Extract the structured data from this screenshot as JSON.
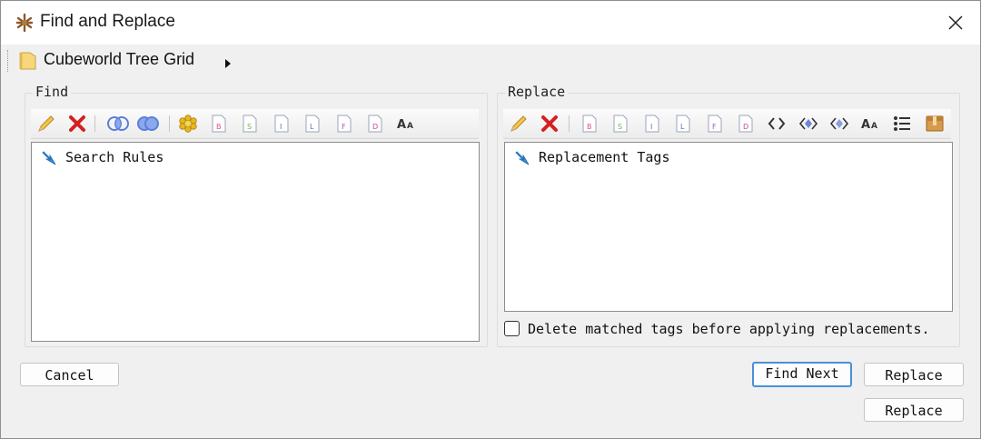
{
  "window": {
    "title": "Find and Replace"
  },
  "breadcrumb": {
    "label": "Cubeworld Tree Grid"
  },
  "find": {
    "legend": "Find",
    "toolbar": [
      "pencil-edit-icon",
      "delete-x-icon",
      "intersect-icon",
      "union-icon",
      "wildcard-icon",
      "doc-b-icon",
      "doc-s-icon",
      "doc-i-icon",
      "doc-l-icon",
      "doc-f-icon",
      "doc-d-icon",
      "font-case-icon"
    ],
    "root_item": "Search Rules"
  },
  "replace": {
    "legend": "Replace",
    "toolbar": [
      "pencil-edit-icon",
      "delete-x-icon",
      "doc-b-icon",
      "doc-s-icon",
      "doc-i-icon",
      "doc-l-icon",
      "doc-f-icon",
      "doc-d-icon",
      "code-brackets-icon",
      "diamond-left-icon",
      "diamond-right-icon",
      "font-case-icon",
      "list-icon",
      "box-icon"
    ],
    "root_item": "Replacement Tags",
    "checkbox_label": "Delete matched tags before applying replacements.",
    "checkbox_checked": false
  },
  "buttons": {
    "cancel": "Cancel",
    "find_next": "Find Next",
    "replace": "Replace",
    "replace_all": "Replace"
  }
}
